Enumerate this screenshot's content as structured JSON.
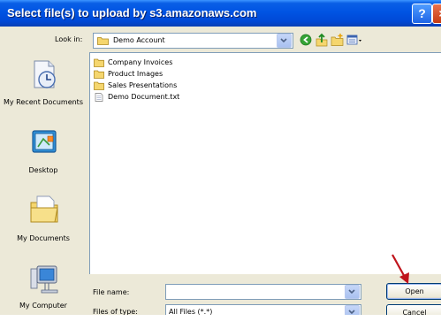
{
  "window": {
    "title": "Select file(s) to upload by s3.amazonaws.com",
    "help_label": "?",
    "close_label": "×"
  },
  "lookin": {
    "label": "Look in:",
    "value": "Demo Account"
  },
  "toolbar": {
    "icons": [
      "back-icon",
      "up-folder-icon",
      "new-folder-icon",
      "views-menu-icon"
    ]
  },
  "places": [
    {
      "label": "My Recent Documents",
      "icon": "recent-documents-icon"
    },
    {
      "label": "Desktop",
      "icon": "desktop-icon"
    },
    {
      "label": "My Documents",
      "icon": "my-documents-icon"
    },
    {
      "label": "My Computer",
      "icon": "my-computer-icon"
    }
  ],
  "files": [
    {
      "name": "Company Invoices",
      "type": "folder"
    },
    {
      "name": "Product Images",
      "type": "folder"
    },
    {
      "name": "Sales Presentations",
      "type": "folder"
    },
    {
      "name": "Demo Document.txt",
      "type": "text"
    }
  ],
  "filename": {
    "label": "File name:",
    "value": ""
  },
  "filetype": {
    "label": "Files of type:",
    "value": "All Files (*.*)"
  },
  "buttons": {
    "open": "Open",
    "cancel": "Cancel"
  },
  "colors": {
    "titlebar": "#0054e3",
    "dialog_bg": "#ece9d8",
    "annotation_arrow": "#c0141c"
  }
}
